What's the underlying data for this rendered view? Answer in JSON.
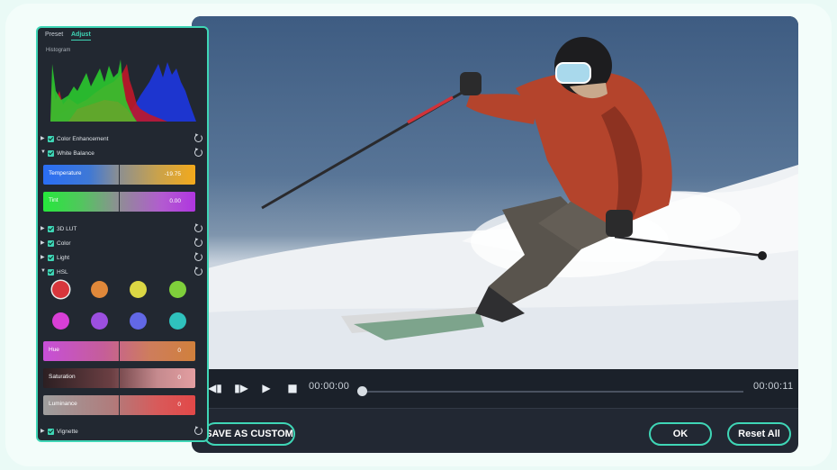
{
  "panel": {
    "tabs": [
      "Preset",
      "Adjust"
    ],
    "histogram_label": "Histogram",
    "sections": {
      "color_enhancement": "Color Enhancement",
      "white_balance": "White Balance",
      "lut3d": "3D LUT",
      "color": "Color",
      "light": "Light",
      "hsl": "HSL",
      "vignette": "Vignette"
    },
    "sliders": {
      "temperature": {
        "label": "Temperature",
        "value": "-19.75"
      },
      "tint": {
        "label": "Tint",
        "value": "0.00"
      },
      "hue": {
        "label": "Hue",
        "value": "0"
      },
      "saturation": {
        "label": "Saturation",
        "value": "0"
      },
      "luminance": {
        "label": "Luminance",
        "value": "0"
      }
    },
    "hsl_colors": [
      "#d8363c",
      "#e0883a",
      "#dbd744",
      "#7fcf3b",
      "#d83fd6",
      "#9c4fe0",
      "#6268e6",
      "#2fc2bd"
    ]
  },
  "player": {
    "current_time": "00:00:00",
    "total_time": "00:00:11",
    "progress": 0
  },
  "buttons": {
    "save_custom": "SAVE AS CUSTOM",
    "ok": "OK",
    "reset_all": "Reset All"
  },
  "icons": {
    "prev_frame": "step-back-icon",
    "next_frame": "step-forward-icon",
    "play": "play-icon",
    "stop": "stop-icon",
    "reset": "reset-icon",
    "expand": "triangle-right-icon"
  },
  "colors": {
    "accent": "#3fd6b6",
    "panel_bg": "#222831",
    "editor_bg": "#222833"
  }
}
